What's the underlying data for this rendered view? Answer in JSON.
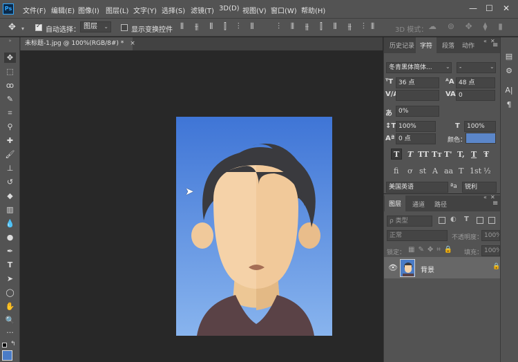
{
  "app": {
    "logo": "Ps"
  },
  "menu": [
    "文件(F)",
    "编辑(E)",
    "图像(I)",
    "图层(L)",
    "文字(Y)",
    "选择(S)",
    "滤镜(T)",
    "3D(D)",
    "视图(V)",
    "窗口(W)",
    "帮助(H)"
  ],
  "window_controls": {
    "minimize": "—",
    "maximize": "☐",
    "close": "✕"
  },
  "options": {
    "auto_select_label": "自动选择：",
    "auto_select_checked": true,
    "auto_select_value": "图层",
    "show_transform_label": "显示变换控件",
    "show_transform_checked": false,
    "mode_3d_label": "3D 模式："
  },
  "document": {
    "tab_title": "未标题-1.jpg @ 100%(RGB/8#) *",
    "close": "×",
    "bg_top": "#3f75d6",
    "bg_bottom": "#88b4ee",
    "hair_color": "#3a3a3e",
    "skin_light": "#f5d2a8",
    "skin_shade": "#e8c08e",
    "shirt_color": "#5a4246"
  },
  "panels": {
    "char_tabs": [
      "历史记录",
      "字符",
      "段落",
      "动作"
    ],
    "char_active": 1,
    "font_family": "冬青黑体简体...",
    "font_style": "-",
    "font_size": "36 点",
    "leading": "48 点",
    "kerning": "",
    "tracking": "0",
    "tsume": "0%",
    "vscale": "100%",
    "hscale": "100%",
    "baseline": "0 点",
    "color_label": "颜色：",
    "text_color": "#5b86c9",
    "style_buttons": [
      "T",
      "T",
      "TT",
      "Tт",
      "T'",
      "T,",
      "T",
      "Ŧ"
    ],
    "glyph_buttons": [
      "fi",
      "ơ",
      "st",
      "A",
      "aa",
      "T",
      "1st",
      "½"
    ],
    "language": "美国英语",
    "antialias": "锐利",
    "aa_icon": "ªa"
  },
  "layers": {
    "tabs": [
      "图层",
      "通道",
      "路径"
    ],
    "active": 0,
    "filter_label": "ρ 类型",
    "blend_mode": "正常",
    "opacity_label": "不透明度：",
    "opacity": "100%",
    "lock_label": "锁定：",
    "fill_label": "填充：",
    "fill": "100%",
    "items": [
      {
        "name": "背景",
        "visible": true,
        "locked": true
      }
    ]
  }
}
